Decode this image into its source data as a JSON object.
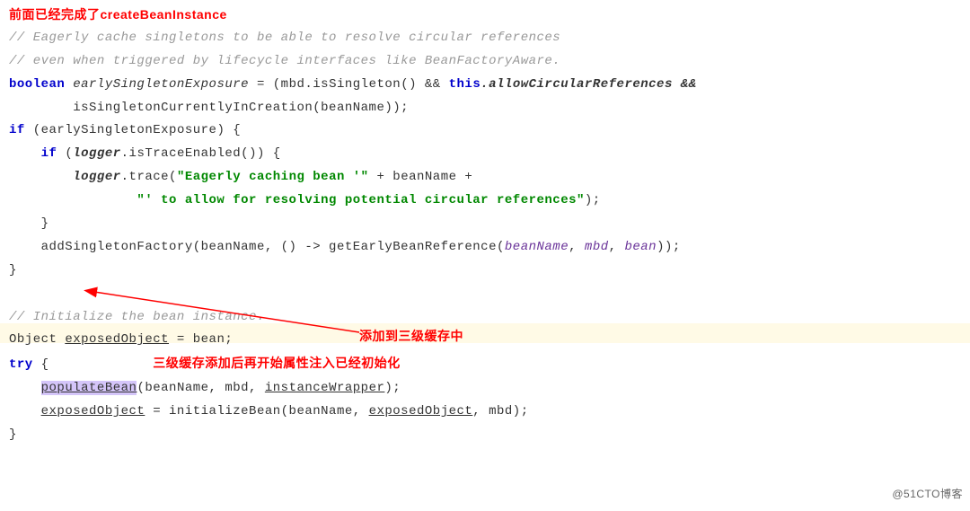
{
  "annotation_top": "前面已经完成了createBeanInstance",
  "comment_line1": "// Eagerly cache singletons to be able to resolve circular references",
  "comment_line2": "// even when triggered by lifecycle interfaces like BeanFactoryAware.",
  "kw_boolean": "boolean",
  "var_early": "earlySingletonExposure",
  "expr_part1": " = (mbd.isSingleton() && ",
  "kw_this": "this",
  "expr_part2": ".allowCircularReferences && ",
  "expr_line2": "        isSingletonCurrentlyInCreation(beanName));",
  "kw_if1": "if",
  "cond_if1": " (earlySingletonExposure) {",
  "kw_if2": "if",
  "cond_if2_open": " (",
  "logger_var": "logger",
  "cond_if2_rest": ".isTraceEnabled()) {",
  "logger_call": ".trace(",
  "str_part1": "\"Eagerly caching bean '\"",
  "plus_bean": " + beanName +",
  "str_part2": "\"' to allow for resolving potential circular references\"",
  "paren_close_semi": ");",
  "cb1": "    }",
  "add_line_start": "    addSingletonFactory(beanName, () -> getEarlyBeanReference(",
  "p_beanName": "beanName",
  "p_mbd": "mbd",
  "p_bean": "bean",
  "add_line_end": "));",
  "cb2": "}",
  "arrow_label": "添加到三级缓存中",
  "comment_init": "// Initialize the bean instance.",
  "obj_line_start": "Object ",
  "exposedObject": "exposedObject",
  "obj_line_end": " = bean;",
  "kw_try": "try",
  "try_open": " {",
  "annotation_inline": "三级缓存添加后再开始属性注入已经初始化",
  "populate": "populateBean",
  "populate_args_open": "(beanName, mbd, ",
  "instanceWrapper": "instanceWrapper",
  "populate_close": ");",
  "init_line_mid": " = initializeBean(beanName, ",
  "init_line_end": ", mbd);",
  "cb3": "}",
  "watermark": "@51CTO博客"
}
